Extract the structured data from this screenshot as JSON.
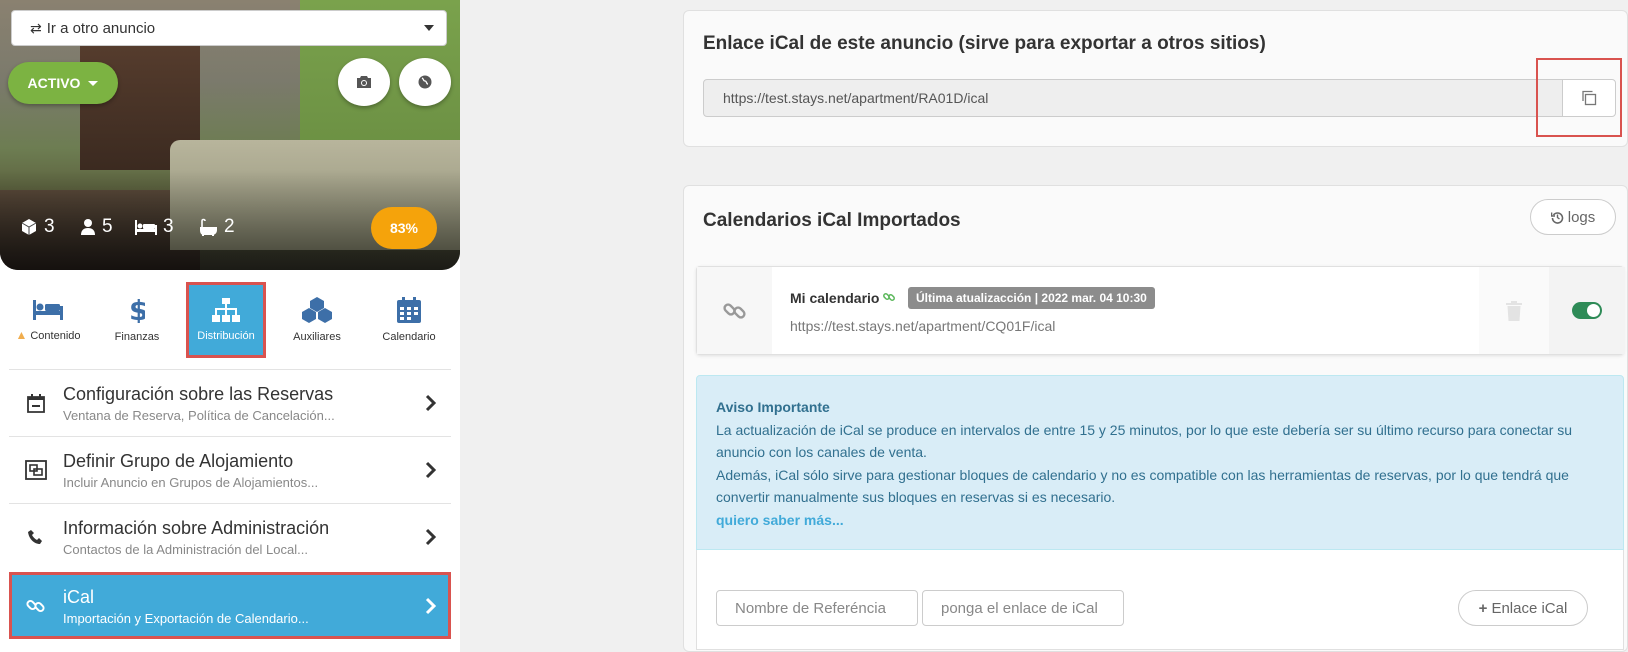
{
  "listing_selector": {
    "label": "Ir a otro anuncio"
  },
  "status": {
    "label": "ACTIVO",
    "color": "#7cb342"
  },
  "stats": {
    "rooms": "3",
    "guests": "5",
    "beds": "3",
    "baths": "2"
  },
  "score": {
    "label": "83%",
    "color": "#f5a30b"
  },
  "tabs": [
    {
      "label": "Contenido",
      "icon": "bed-icon",
      "warning": true
    },
    {
      "label": "Finanzas",
      "icon": "dollar-icon"
    },
    {
      "label": "Distribución",
      "icon": "sitemap-icon",
      "active": true
    },
    {
      "label": "Auxiliares",
      "icon": "cubes-icon"
    },
    {
      "label": "Calendario",
      "icon": "calendar-icon"
    }
  ],
  "menu": [
    {
      "title": "Configuración sobre las Reservas",
      "subtitle": "Ventana de Reserva, Política de Cancelación...",
      "icon": "calendar-minus-icon"
    },
    {
      "title": "Definir Grupo de Alojamiento",
      "subtitle": "Incluir Anuncio en Grupos de Alojamientos...",
      "icon": "object-group-icon"
    },
    {
      "title": "Información sobre Administración",
      "subtitle": "Contactos de la Administración del Local...",
      "icon": "phone-icon"
    },
    {
      "title": "iCal",
      "subtitle": "Importación y Exportación de Calendario...",
      "icon": "link-icon",
      "active": true
    }
  ],
  "export": {
    "title": "Enlace iCal de este anuncio (sirve para exportar a otros sitios)",
    "url": "https://test.stays.net/apartment/RA01D/ical"
  },
  "import": {
    "title": "Calendarios iCal Importados",
    "logs_label": "logs",
    "calendar": {
      "name": "Mi calendario",
      "badge": "Última atualizacción | 2022 mar. 04 10:30",
      "url": "https://test.stays.net/apartment/CQ01F/ical",
      "enabled": true
    },
    "notice": {
      "title": "Aviso Importante",
      "line1": "La actualización de iCal se produce en intervalos de entre 15 y 25 minutos, por lo que este debería ser su último recurso para conectar su anuncio con los canales de venta.",
      "line2": "Además, iCal sólo sirve para gestionar bloques de calendario y no es compatible con las herramientas de reservas, por lo que tendrá que convertir manualmente sus bloques en reservas si es necesario.",
      "link": "quiero saber más..."
    },
    "form": {
      "name_placeholder": "Nombre de Referéncia",
      "url_placeholder": "ponga el enlace de iCal",
      "add_label": "Enlace iCal"
    }
  },
  "colors": {
    "accent": "#41aad9",
    "highlight": "#d9534f",
    "icon_blue": "#3d6fa8",
    "notice_text": "#31708f"
  }
}
